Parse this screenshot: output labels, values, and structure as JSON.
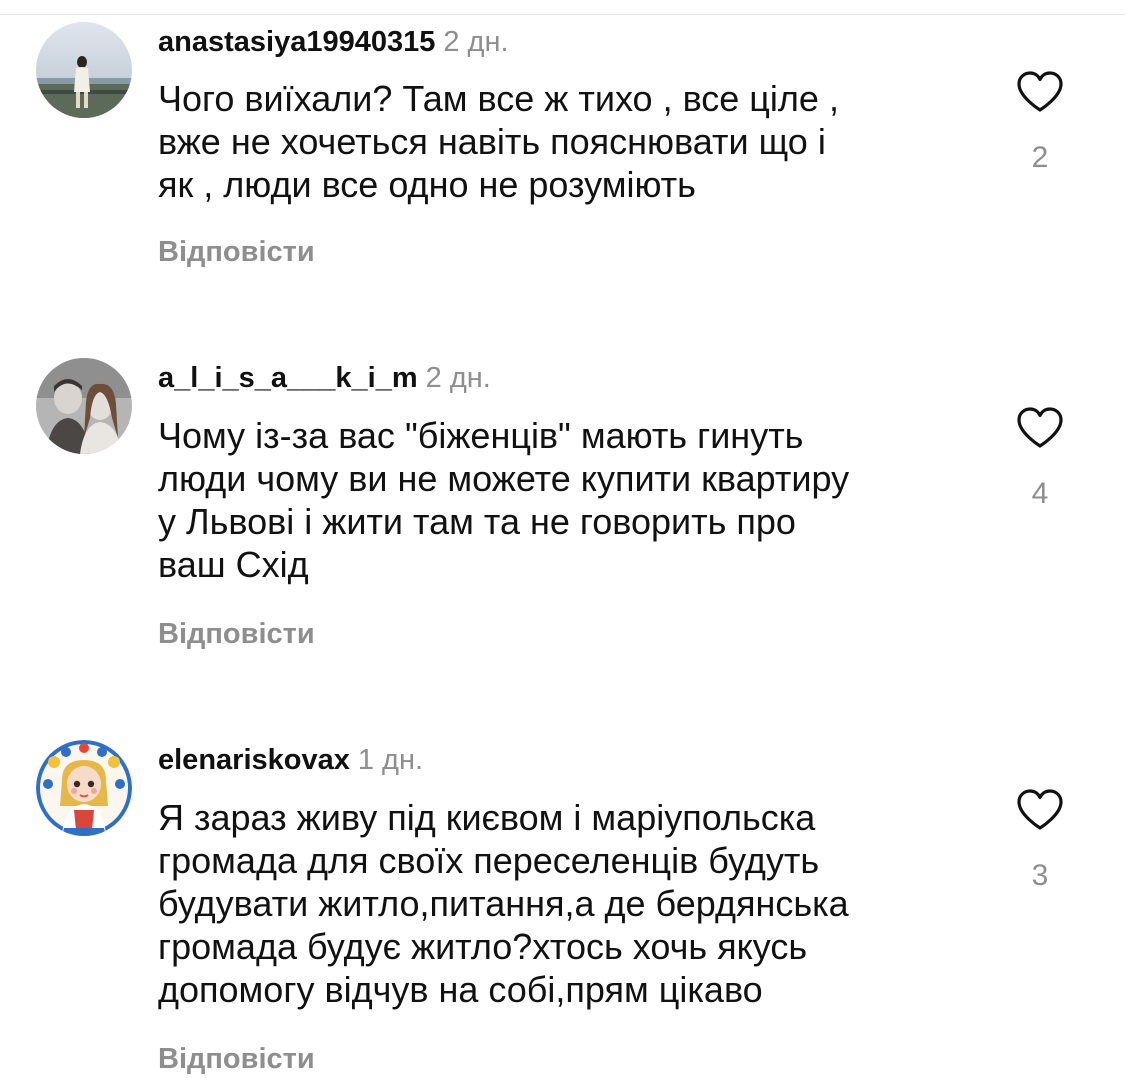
{
  "comments": [
    {
      "username": "anastasiya19940315",
      "time": "2 дн.",
      "text": "Чого виїхали? Там все ж тихо , все ціле ,\nвже не хочеться навіть пояснювати що і\nяк , люди все одно не розуміють",
      "likes": "2",
      "reply_label": "Відповісти",
      "avatar_icon": "user-photo-avatar"
    },
    {
      "username": "a_l_i_s_a___k_i_m",
      "time": "2 дн.",
      "text": "Чому із-за вас \"біженців\" мають гинуть\nлюди чому ви не можете купити квартиру\nу Львові і жити там та не говорить про\nваш Схід",
      "likes": "4",
      "reply_label": "Відповісти",
      "avatar_icon": "user-photo-avatar"
    },
    {
      "username": "elenariskovax",
      "time": "1 дн.",
      "text": "Я зараз живу під києвом і маріупольска\nгромада для своїх переселенців будуть\nбудувати житло,питання,а де бердянська\nгромада будує житло?хтось хочь якусь\nдопомогу відчув на собі,прям цікаво",
      "likes": "3",
      "reply_label": "Відповісти",
      "avatar_icon": "illustrated-girl-avatar"
    }
  ],
  "colors": {
    "text": "#111111",
    "secondary": "#8e8e8e",
    "divider": "#e6e6e6"
  }
}
